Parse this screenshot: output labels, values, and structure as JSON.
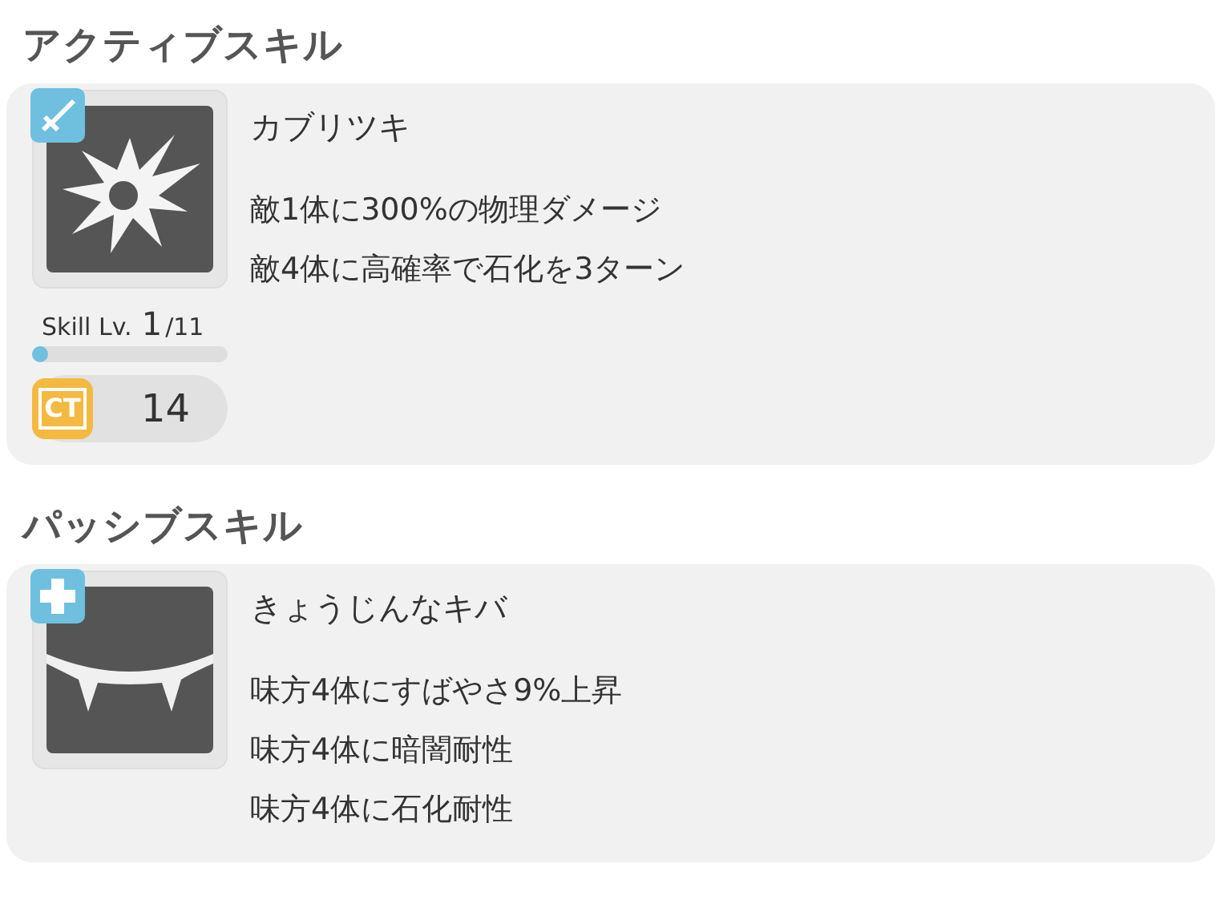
{
  "sections": [
    {
      "title": "アクティブスキル",
      "skill": {
        "name": "カブリツキ",
        "kind": "active",
        "lines": [
          "敵1体に300%の物理ダメージ",
          "敵4体に高確率で石化を3ターン"
        ],
        "skill_level": {
          "label": "Skill Lv.",
          "current": "1",
          "max": "/11",
          "level": 0.08
        },
        "ct": {
          "label": "CT",
          "value": "14"
        }
      }
    },
    {
      "title": "パッシブスキル",
      "skill": {
        "name": "きょうじんなキバ",
        "kind": "passive",
        "lines": [
          "味方4体にすばやさ9%上昇",
          "味方4体に暗闇耐性",
          "味方4体に石化耐性"
        ]
      }
    }
  ]
}
